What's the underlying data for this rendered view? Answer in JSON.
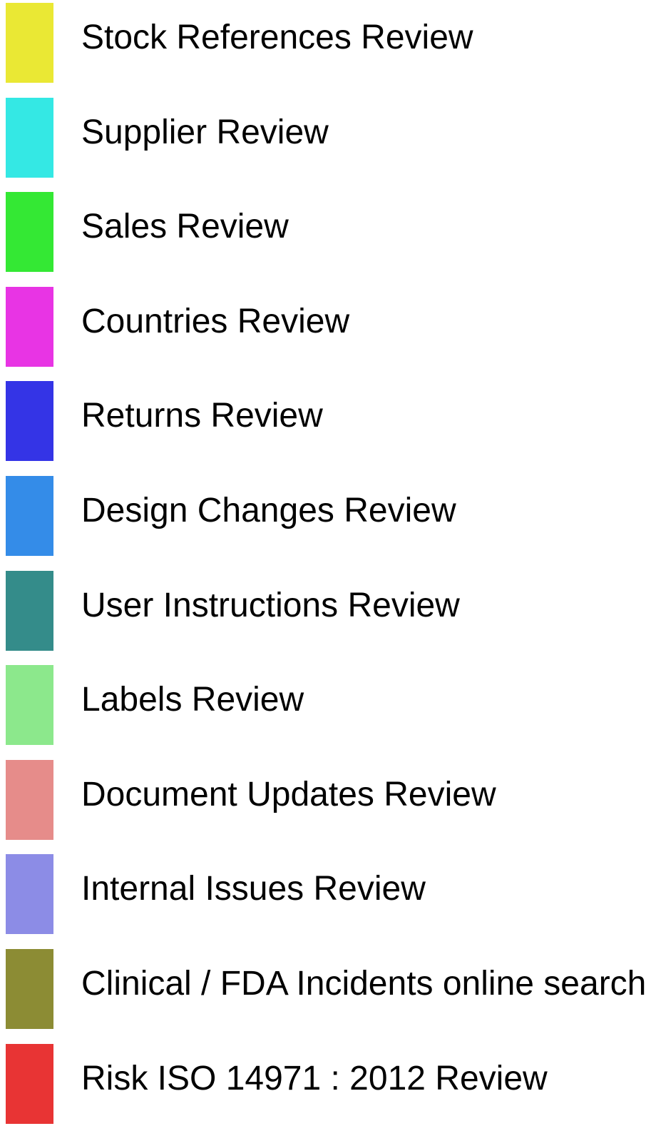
{
  "chart_data": {
    "type": "legend",
    "legend": [
      {
        "label": "Stock References Review",
        "color": "#eae834"
      },
      {
        "label": "Supplier Review",
        "color": "#34e8e4"
      },
      {
        "label": "Sales Review",
        "color": "#34e834"
      },
      {
        "label": "Countries Review",
        "color": "#e834e4"
      },
      {
        "label": "Returns Review",
        "color": "#3434e6"
      },
      {
        "label": "Design Changes Review",
        "color": "#348ce8"
      },
      {
        "label": "User Instructions Review",
        "color": "#348c8a"
      },
      {
        "label": "Labels Review",
        "color": "#8ce88c"
      },
      {
        "label": "Document Updates Review",
        "color": "#e68c8a"
      },
      {
        "label": "Internal Issues Review",
        "color": "#8c8ce6"
      },
      {
        "label": "Clinical / FDA Incidents online search",
        "color": "#8c8c34"
      },
      {
        "label": "Risk ISO 14971 : 2012 Review",
        "color": "#e83434"
      }
    ]
  }
}
